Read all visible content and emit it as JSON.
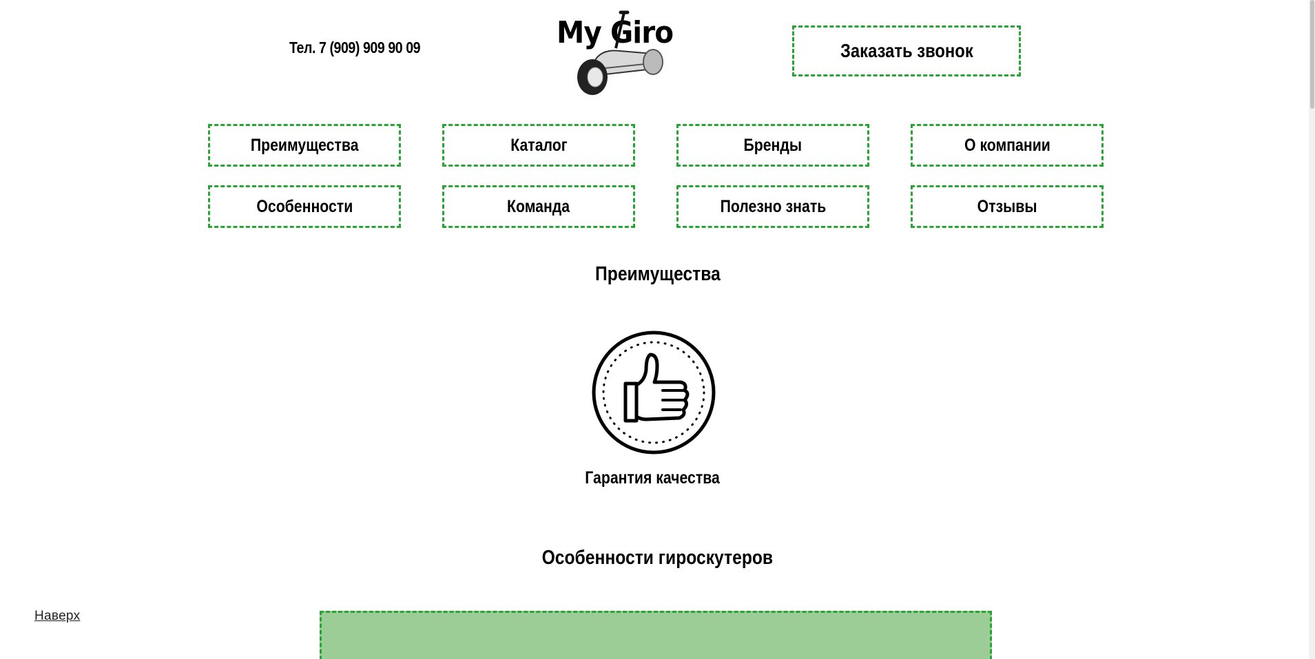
{
  "header": {
    "phone": "Тел. 7 (909) 909 90 09",
    "logo_text": "My Giro",
    "callback_label": "Заказать звонок"
  },
  "nav": {
    "row1": [
      "Преимущества",
      "Каталог",
      "Бренды",
      "О компании"
    ],
    "row2": [
      "Особенности",
      "Команда",
      "Полезно знать",
      "Отзывы"
    ]
  },
  "advantages": {
    "title": "Преимущества",
    "item_icon": "thumbs-up-icon",
    "item_caption": "Гарантия качества"
  },
  "features": {
    "title": "Особенности гироскутеров"
  },
  "to_top_label": "Наверх",
  "colors": {
    "accent_border": "#27a533",
    "features_bg": "#9ccd96"
  }
}
